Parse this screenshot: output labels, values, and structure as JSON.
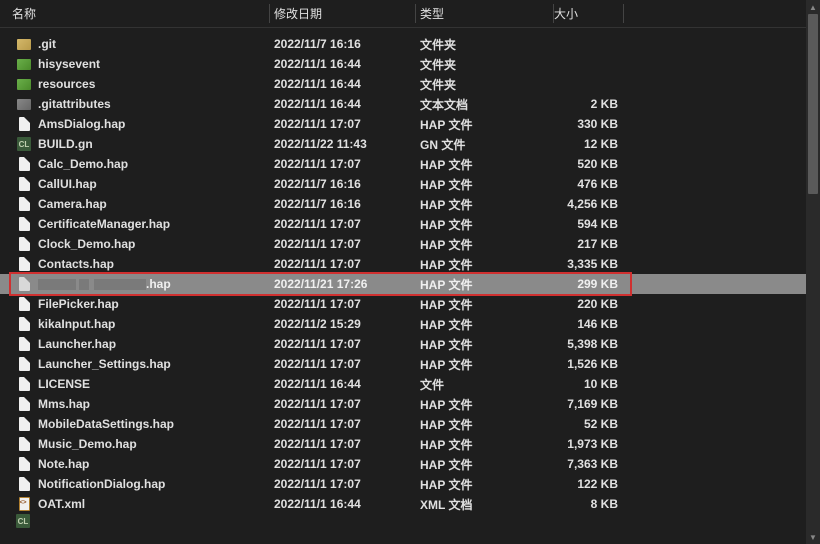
{
  "headers": {
    "name": "名称",
    "date": "修改日期",
    "type": "类型",
    "size": "大小"
  },
  "files": [
    {
      "icon": "folder",
      "name": ".git",
      "date": "2022/11/7 16:16",
      "type": "文件夹",
      "size": ""
    },
    {
      "icon": "folder-green",
      "name": "hisysevent",
      "date": "2022/11/1 16:44",
      "type": "文件夹",
      "size": ""
    },
    {
      "icon": "folder-green",
      "name": "resources",
      "date": "2022/11/1 16:44",
      "type": "文件夹",
      "size": ""
    },
    {
      "icon": "folder-gray",
      "name": ".gitattributes",
      "date": "2022/11/1 16:44",
      "type": "文本文档",
      "size": "2 KB"
    },
    {
      "icon": "file",
      "name": "AmsDialog.hap",
      "date": "2022/11/1 17:07",
      "type": "HAP 文件",
      "size": "330 KB"
    },
    {
      "icon": "cl",
      "name": "BUILD.gn",
      "date": "2022/11/22 11:43",
      "type": "GN 文件",
      "size": "12 KB"
    },
    {
      "icon": "file",
      "name": "Calc_Demo.hap",
      "date": "2022/11/1 17:07",
      "type": "HAP 文件",
      "size": "520 KB"
    },
    {
      "icon": "file",
      "name": "CallUI.hap",
      "date": "2022/11/7 16:16",
      "type": "HAP 文件",
      "size": "476 KB"
    },
    {
      "icon": "file",
      "name": "Camera.hap",
      "date": "2022/11/7 16:16",
      "type": "HAP 文件",
      "size": "4,256 KB"
    },
    {
      "icon": "file",
      "name": "CertificateManager.hap",
      "date": "2022/11/1 17:07",
      "type": "HAP 文件",
      "size": "594 KB"
    },
    {
      "icon": "file",
      "name": "Clock_Demo.hap",
      "date": "2022/11/1 17:07",
      "type": "HAP 文件",
      "size": "217 KB"
    },
    {
      "icon": "file",
      "name": "Contacts.hap",
      "date": "2022/11/1 17:07",
      "type": "HAP 文件",
      "size": "3,335 KB"
    },
    {
      "icon": "file-sel",
      "obscured": true,
      "suffix": ".hap",
      "date": "2022/11/21 17:26",
      "type": "HAP 文件",
      "size": "299 KB",
      "highlighted": true
    },
    {
      "icon": "file",
      "name": "FilePicker.hap",
      "date": "2022/11/1 17:07",
      "type": "HAP 文件",
      "size": "220 KB"
    },
    {
      "icon": "file",
      "name": "kikaInput.hap",
      "date": "2022/11/2 15:29",
      "type": "HAP 文件",
      "size": "146 KB"
    },
    {
      "icon": "file",
      "name": "Launcher.hap",
      "date": "2022/11/1 17:07",
      "type": "HAP 文件",
      "size": "5,398 KB"
    },
    {
      "icon": "file",
      "name": "Launcher_Settings.hap",
      "date": "2022/11/1 17:07",
      "type": "HAP 文件",
      "size": "1,526 KB"
    },
    {
      "icon": "file",
      "name": "LICENSE",
      "date": "2022/11/1 16:44",
      "type": "文件",
      "size": "10 KB"
    },
    {
      "icon": "file",
      "name": "Mms.hap",
      "date": "2022/11/1 17:07",
      "type": "HAP 文件",
      "size": "7,169 KB"
    },
    {
      "icon": "file",
      "name": "MobileDataSettings.hap",
      "date": "2022/11/1 17:07",
      "type": "HAP 文件",
      "size": "52 KB"
    },
    {
      "icon": "file",
      "name": "Music_Demo.hap",
      "date": "2022/11/1 17:07",
      "type": "HAP 文件",
      "size": "1,973 KB"
    },
    {
      "icon": "file",
      "name": "Note.hap",
      "date": "2022/11/1 17:07",
      "type": "HAP 文件",
      "size": "7,363 KB"
    },
    {
      "icon": "file",
      "name": "NotificationDialog.hap",
      "date": "2022/11/1 17:07",
      "type": "HAP 文件",
      "size": "122 KB"
    },
    {
      "icon": "xml",
      "name": "OAT.xml",
      "date": "2022/11/1 16:44",
      "type": "XML 文档",
      "size": "8 KB"
    }
  ]
}
